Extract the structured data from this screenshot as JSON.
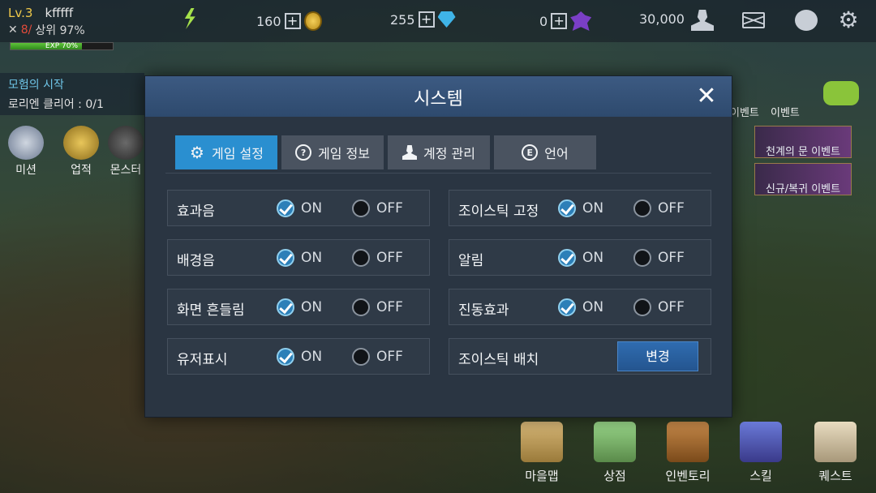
{
  "player": {
    "level": "Lv.3",
    "name": "kfffff",
    "rank_num": "8/",
    "rank_text": "상위 97%",
    "exp_label": "EXP 70%",
    "exp_percent": 70
  },
  "currencies": [
    {
      "value": "160",
      "icon": "gold-coin-icon"
    },
    {
      "value": "255",
      "icon": "diamond-gem-icon"
    },
    {
      "value": "0",
      "icon": "purple-crystal-icon"
    },
    {
      "value": "30,000",
      "icon": "friend-points-icon"
    }
  ],
  "quest": {
    "title": "모험의 시작",
    "progress": "로리엔 클리어 : 0/1"
  },
  "left_menu": [
    "미션",
    "업적",
    "몬스터"
  ],
  "events": {
    "label_1": "이벤트",
    "label_2": "이벤트",
    "banner_1": "천계의 문 이벤트",
    "banner_2": "신규/복귀 이벤트"
  },
  "bottom_nav": [
    "마을맵",
    "상점",
    "인벤토리",
    "스킬",
    "퀘스트"
  ],
  "dialog": {
    "title": "시스템",
    "tabs": [
      {
        "label": "게임 설정",
        "icon": "gear-icon",
        "active": true
      },
      {
        "label": "게임 정보",
        "icon": "question-icon",
        "active": false
      },
      {
        "label": "계정 관리",
        "icon": "user-icon",
        "active": false
      },
      {
        "label": "언어",
        "icon": "language-e-icon",
        "active": false
      }
    ],
    "on_label": "ON",
    "off_label": "OFF",
    "settings_left": [
      {
        "label": "효과음",
        "value": "ON"
      },
      {
        "label": "배경음",
        "value": "ON"
      },
      {
        "label": "화면 흔들림",
        "value": "ON"
      },
      {
        "label": "유저표시",
        "value": "ON"
      }
    ],
    "settings_right": [
      {
        "label": "조이스틱 고정",
        "value": "ON"
      },
      {
        "label": "알림",
        "value": "ON"
      },
      {
        "label": "진동효과",
        "value": "ON"
      }
    ],
    "joystick_layout": {
      "label": "조이스틱 배치",
      "button": "변경"
    }
  },
  "colors": {
    "active_tab": "#2a8fd0",
    "header": "#3c5a82",
    "panel": "#2a3542",
    "check": "#2c7fb8"
  }
}
